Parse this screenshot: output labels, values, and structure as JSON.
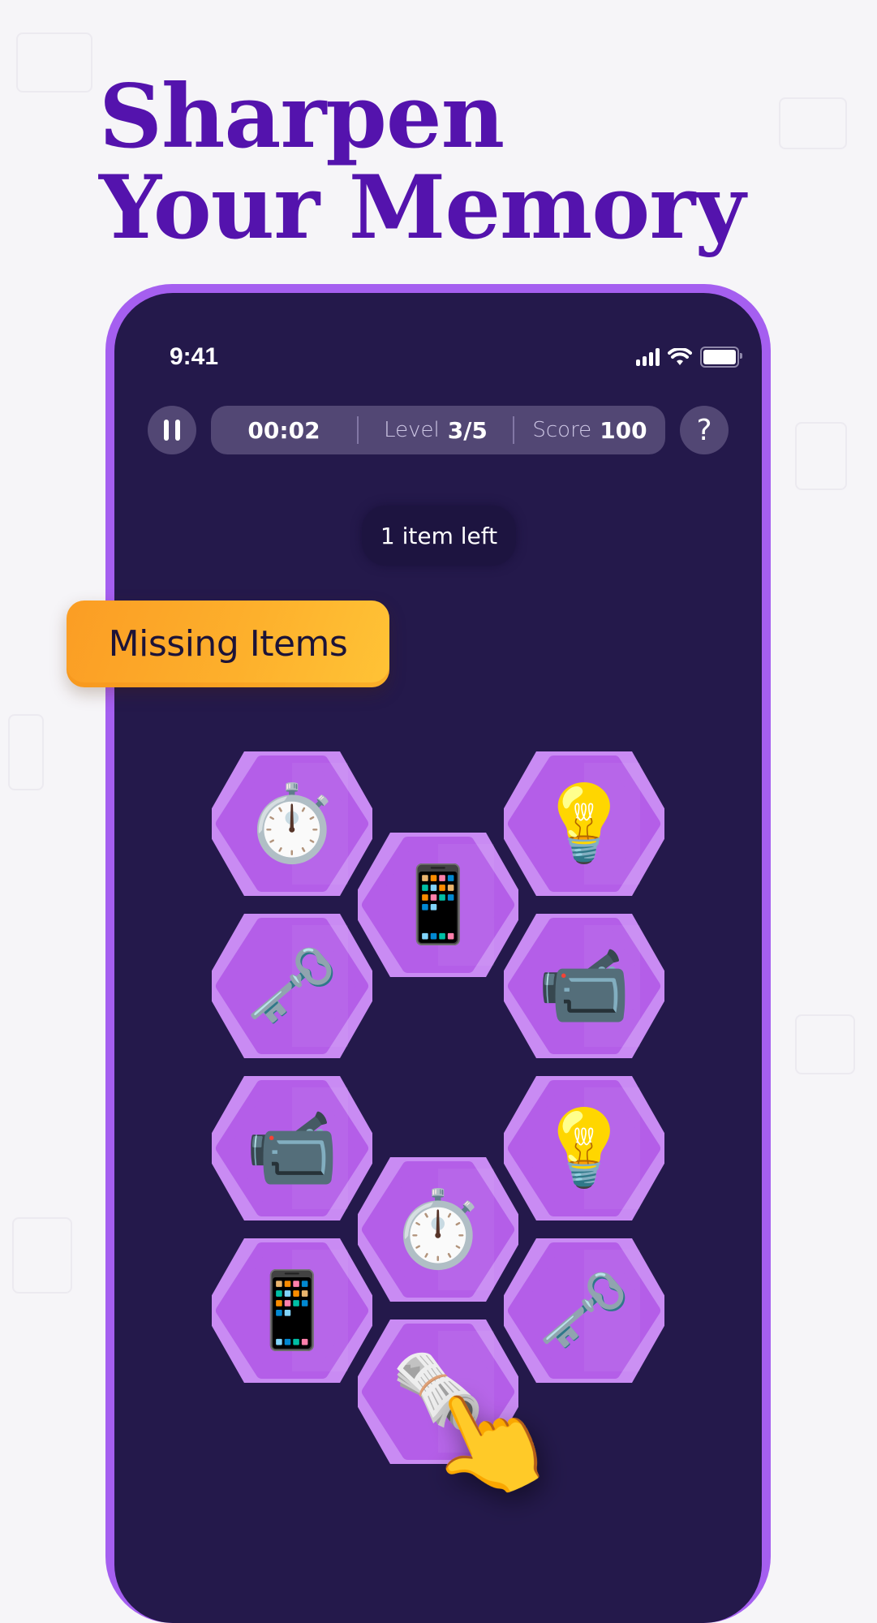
{
  "headline": {
    "line1": "Sharpen",
    "line2": "Your Memory"
  },
  "status_bar": {
    "time": "9:41",
    "signal_bars": 4,
    "wifi": true,
    "battery_percent": 100
  },
  "hud": {
    "pause_icon": "pause-icon",
    "timer": "00:02",
    "level_label": "Level",
    "level_value": "3/5",
    "score_label": "Score",
    "score_value": "100",
    "help_label": "?"
  },
  "items_left": "1 item left",
  "mode_banner": "Missing Items",
  "colors": {
    "headline": "#5413ad",
    "phone_frame": "#a55ff0",
    "screen_bg": "#24194b",
    "hud_bg": "#524774",
    "hex_fill": "#b45ee8",
    "hex_border": "#c98bf3",
    "banner": "#fdb02c"
  },
  "board": {
    "tiles": [
      {
        "id": "tile-1",
        "item": "stopwatch",
        "glyph": "⏱️"
      },
      {
        "id": "tile-2",
        "item": "light-bulb",
        "glyph": "💡"
      },
      {
        "id": "tile-3",
        "item": "mobile-phone",
        "glyph": "📱"
      },
      {
        "id": "tile-4",
        "item": "old-key",
        "glyph": "🗝️"
      },
      {
        "id": "tile-5",
        "item": "video-camera",
        "glyph": "📹"
      },
      {
        "id": "tile-6",
        "item": "video-camera",
        "glyph": "📹"
      },
      {
        "id": "tile-7",
        "item": "light-bulb",
        "glyph": "💡"
      },
      {
        "id": "tile-8",
        "item": "stopwatch",
        "glyph": "⏱️"
      },
      {
        "id": "tile-9",
        "item": "mobile-phone",
        "glyph": "📱"
      },
      {
        "id": "tile-10",
        "item": "old-key",
        "glyph": "🗝️"
      },
      {
        "id": "tile-11",
        "item": "rolled-newspaper",
        "glyph": "🗞️"
      }
    ],
    "pointer": {
      "icon": "pointing-hand-icon",
      "glyph": "👆",
      "target": "tile-11"
    }
  }
}
